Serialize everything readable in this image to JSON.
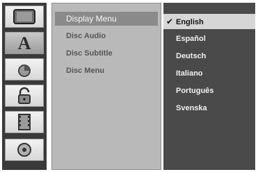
{
  "sidebar": {
    "icons": [
      {
        "name": "tv-display-icon",
        "glyph": "▭"
      },
      {
        "name": "language-icon",
        "glyph": "A"
      },
      {
        "name": "audio-icon",
        "glyph": "◔"
      },
      {
        "name": "lock-icon",
        "glyph": "🔓"
      },
      {
        "name": "film-icon",
        "glyph": "▦"
      },
      {
        "name": "disc-icon",
        "glyph": "◎"
      }
    ]
  },
  "menu": {
    "items": [
      {
        "label": "Display Menu"
      },
      {
        "label": "Disc Audio"
      },
      {
        "label": "Disc Subtitle"
      },
      {
        "label": "Disc Menu"
      }
    ]
  },
  "options": {
    "check": "✔",
    "items": [
      {
        "label": "English"
      },
      {
        "label": "Español"
      },
      {
        "label": "Deutsch"
      },
      {
        "label": "Italiano"
      },
      {
        "label": "Português"
      },
      {
        "label": "Svenska"
      }
    ]
  }
}
